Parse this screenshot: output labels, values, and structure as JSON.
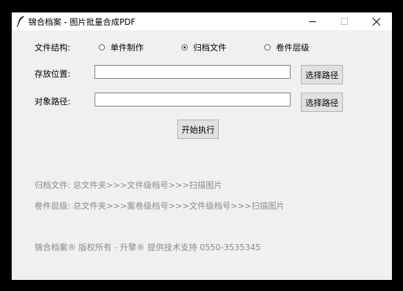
{
  "window": {
    "title": "锦合档案 - 图片批量合成PDF",
    "controls": {
      "minimize": "minimize",
      "maximize": "maximize",
      "close": "close"
    }
  },
  "form": {
    "structure_label": "文件结构:",
    "structure_options": [
      {
        "label": "单件制作",
        "selected": false
      },
      {
        "label": "归档文件",
        "selected": true
      },
      {
        "label": "卷件层级",
        "selected": false
      }
    ],
    "storage_label": "存放位置:",
    "storage_value": "",
    "target_label": "对象路径:",
    "target_value": "",
    "browse_button": "选择路径",
    "run_button": "开始执行"
  },
  "notes": {
    "archive_hint": "归档文件: 总文件夹>>>文件级档号>>>扫描图片",
    "volume_hint": "卷件层级: 总文件夹>>>案卷级档号>>>文件级档号>>>扫描图片",
    "copyright": "锦合档案® 版权所有 - 升擎® 提供技术支持 0550-3535345"
  }
}
